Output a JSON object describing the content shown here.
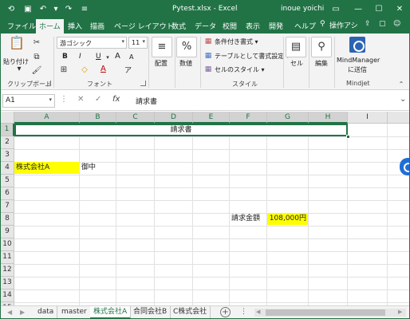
{
  "window": {
    "title": "Pytest.xlsx  -  Excel",
    "user": "inoue yoichi",
    "accent": "#217346"
  },
  "ribbon_tabs": [
    "ファイル",
    "ホーム",
    "挿入",
    "描画",
    "ページ レイアウト",
    "数式",
    "データ",
    "校閲",
    "表示",
    "開発",
    "ヘルプ"
  ],
  "tell_me": "操作アシ",
  "clipboard": {
    "paste": "貼り付け",
    "label": "クリップボード"
  },
  "font": {
    "name": "游ゴシック",
    "size": "11",
    "label": "フォント",
    "bold": "B",
    "italic": "I",
    "underline": "U",
    "grow": "A",
    "shrink": "A",
    "color_a": "A",
    "phonetic": "ア"
  },
  "alignment": {
    "label": "配置"
  },
  "number": {
    "label": "数値",
    "symbol": "%"
  },
  "styles": {
    "conditional": "条件付き書式 ▾",
    "table": "テーブルとして書式設定 ▾",
    "cell_styles": "セルのスタイル ▾",
    "label": "スタイル"
  },
  "cells_group": {
    "label": "セル"
  },
  "editing": {
    "label": "編集"
  },
  "mindjet": {
    "line1": "MindManager",
    "line2": "に送信",
    "label": "Mindjet"
  },
  "formula_bar": {
    "name_box": "A1",
    "cancel": "✕",
    "enter": "✓",
    "fx": "fx",
    "content": "請求書"
  },
  "columns": [
    "A",
    "B",
    "C",
    "D",
    "E",
    "F",
    "G",
    "H",
    "I"
  ],
  "rows": [
    "1",
    "2",
    "3",
    "4",
    "5",
    "6",
    "7",
    "8",
    "9",
    "10",
    "11",
    "12",
    "13",
    "14",
    "15"
  ],
  "cells": {
    "a1": "請求書",
    "a4": "株式会社A",
    "b4": "御中",
    "f8": "請求金額",
    "g8": "108,000円"
  },
  "sheets": [
    "data",
    "master",
    "株式会社A",
    "合同会社B",
    "C株式会社"
  ],
  "active_sheet": "株式会社A",
  "highlight_color": "#ffff00"
}
